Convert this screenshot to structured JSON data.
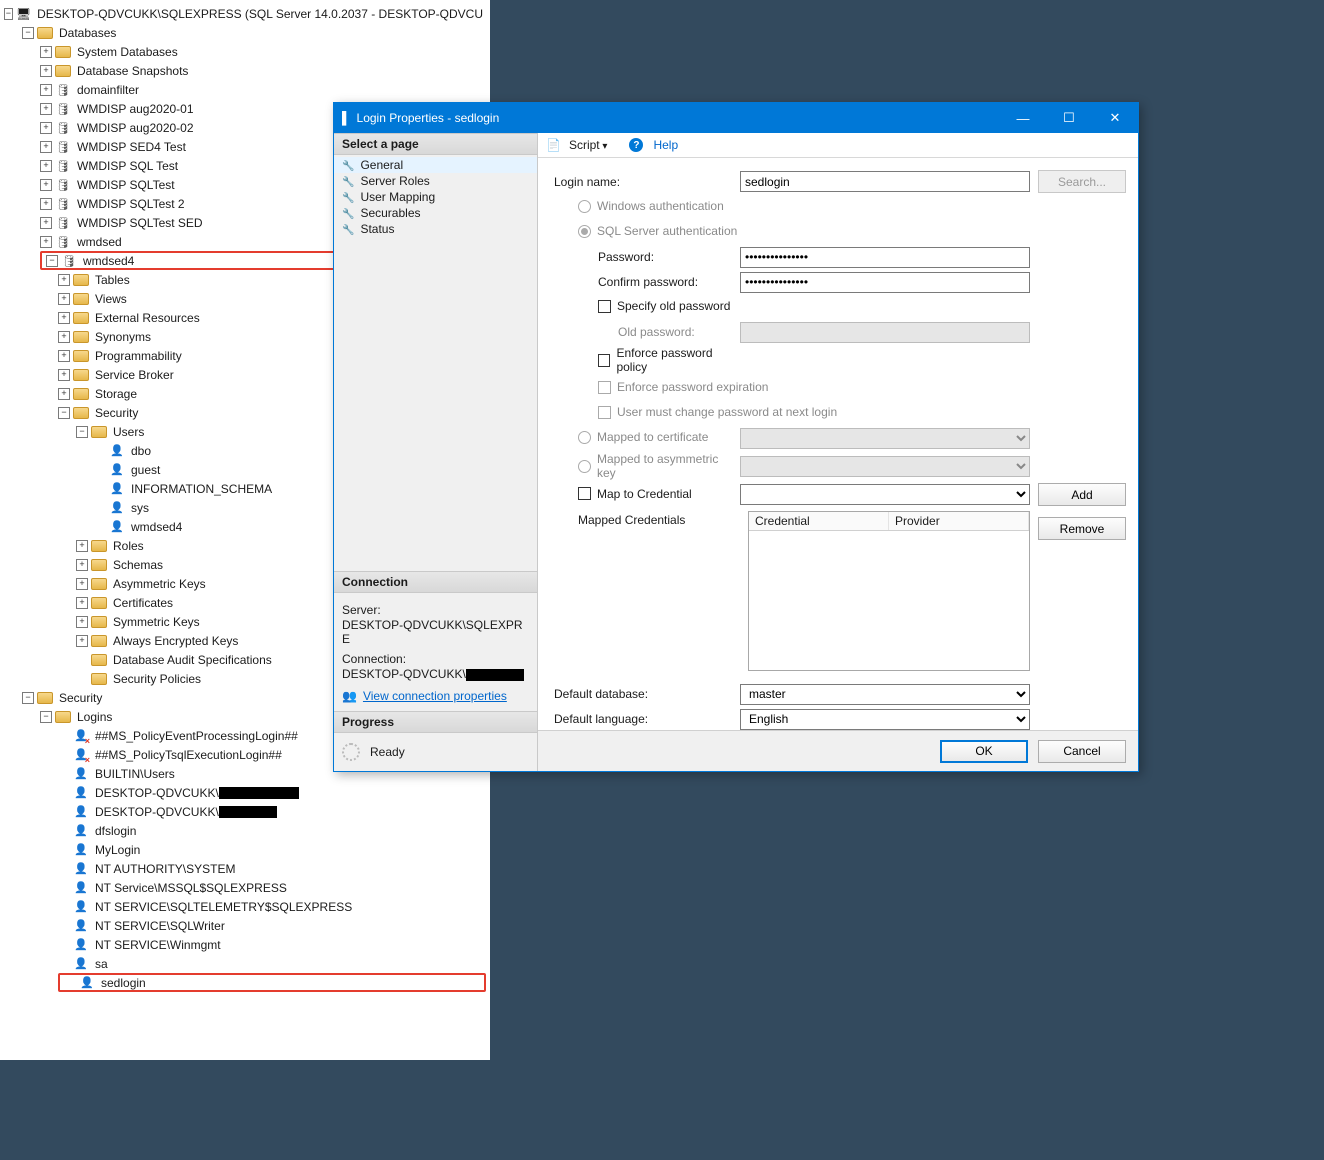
{
  "tree": {
    "root": "DESKTOP-QDVCUKK\\SQLEXPRESS (SQL Server 14.0.2037 - DESKTOP-QDVCU",
    "databases": "Databases",
    "db_children": {
      "sys_db": "System Databases",
      "snap": "Database Snapshots",
      "items": [
        "domainfilter",
        "WMDISP aug2020-01",
        "WMDISP aug2020-02",
        "WMDISP SED4 Test",
        "WMDISP SQL Test",
        "WMDISP SQLTest",
        "WMDISP SQLTest 2",
        "WMDISP SQLTest SED",
        "wmdsed",
        "wmdsed4"
      ]
    },
    "wmdsed4_children": [
      "Tables",
      "Views",
      "External Resources",
      "Synonyms",
      "Programmability",
      "Service Broker",
      "Storage",
      "Security"
    ],
    "db_security_users_label": "Users",
    "db_users": [
      "dbo",
      "guest",
      "INFORMATION_SCHEMA",
      "sys",
      "wmdsed4"
    ],
    "db_security_other": [
      "Roles",
      "Schemas",
      "Asymmetric Keys",
      "Certificates",
      "Symmetric Keys",
      "Always Encrypted Keys",
      "Database Audit Specifications",
      "Security Policies"
    ],
    "server_security": "Security",
    "logins_label": "Logins",
    "logins_x": [
      "##MS_PolicyEventProcessingLogin##",
      "##MS_PolicyTsqlExecutionLogin##"
    ],
    "login_builtin": "BUILTIN\\Users",
    "login_desktop_prefix": "DESKTOP-QDVCUKK\\",
    "logins_plain": [
      "dfslogin",
      "MyLogin",
      "NT AUTHORITY\\SYSTEM",
      "NT Service\\MSSQL$SQLEXPRESS",
      "NT SERVICE\\SQLTELEMETRY$SQLEXPRESS",
      "NT SERVICE\\SQLWriter",
      "NT SERVICE\\Winmgmt",
      "sa",
      "sedlogin"
    ]
  },
  "dialog": {
    "title": "Login Properties - sedlogin",
    "select_page": "Select a page",
    "pages": [
      "General",
      "Server Roles",
      "User Mapping",
      "Securables",
      "Status"
    ],
    "connection_head": "Connection",
    "server_label": "Server:",
    "server_value": "DESKTOP-QDVCUKK\\SQLEXPRE",
    "conn_label": "Connection:",
    "conn_value": "DESKTOP-QDVCUKK\\",
    "view_conn": "View connection properties",
    "progress_head": "Progress",
    "progress_value": "Ready",
    "toolbar_script": "Script",
    "toolbar_help": "Help",
    "form": {
      "login_name_label": "Login name:",
      "login_name_value": "sedlogin",
      "search_btn": "Search...",
      "win_auth": "Windows authentication",
      "sql_auth": "SQL Server authentication",
      "password_label": "Password:",
      "password_value": "•••••••••••••••",
      "confirm_label": "Confirm password:",
      "confirm_value": "•••••••••••••••",
      "specify_old": "Specify old password",
      "old_pw_label": "Old password:",
      "enforce_policy": "Enforce password policy",
      "enforce_exp": "Enforce password expiration",
      "must_change": "User must change password at next login",
      "mapped_cert": "Mapped to certificate",
      "mapped_asym": "Mapped to asymmetric key",
      "map_cred": "Map to Credential",
      "mapped_creds": "Mapped Credentials",
      "col_cred": "Credential",
      "col_prov": "Provider",
      "add_btn": "Add",
      "remove_btn": "Remove",
      "def_db_label": "Default database:",
      "def_db_value": "master",
      "def_lang_label": "Default language:",
      "def_lang_value": "English"
    },
    "footer": {
      "ok": "OK",
      "cancel": "Cancel"
    }
  }
}
